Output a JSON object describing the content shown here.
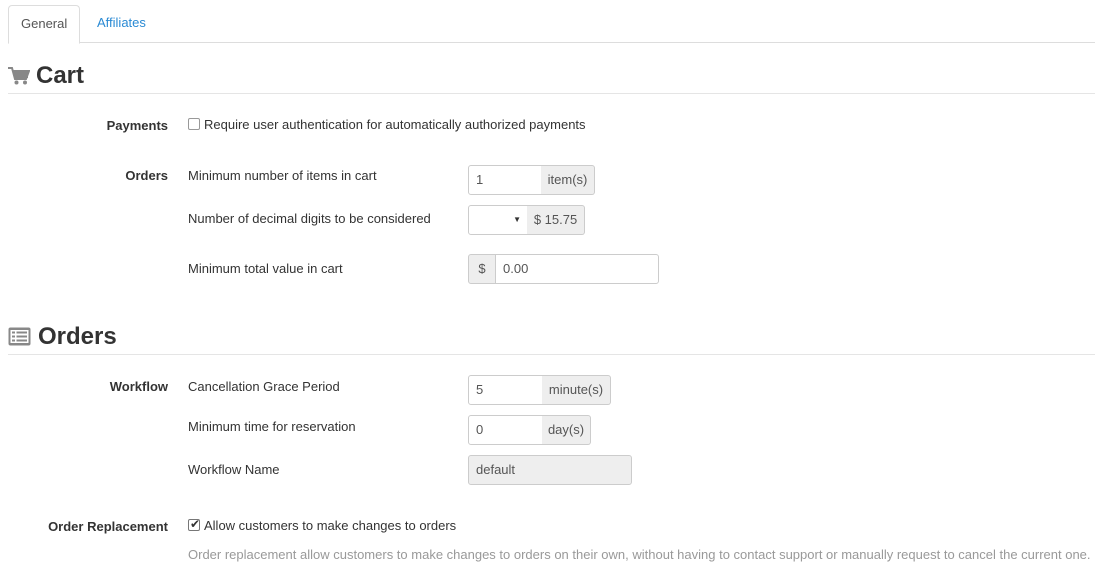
{
  "tabs": {
    "general": "General",
    "affiliates": "Affiliates"
  },
  "cart_section": {
    "title": "Cart",
    "icon": "shopping-cart-icon",
    "payments": {
      "label": "Payments",
      "checkbox_text": "Require user authentication for automatically authorized payments",
      "checked": false
    },
    "orders": {
      "label": "Orders",
      "min_items": {
        "label": "Minimum number of items in cart",
        "value": "1",
        "addon": "item(s)"
      },
      "decimal_digits": {
        "label": "Number of decimal digits to be considered",
        "value": "",
        "preview": "$ 15.75"
      },
      "min_total": {
        "label": "Minimum total value in cart",
        "prefix": "$",
        "value": "0.00"
      }
    }
  },
  "orders_section": {
    "title": "Orders",
    "icon": "list-icon",
    "workflow": {
      "label": "Workflow",
      "grace_period": {
        "label": "Cancellation Grace Period",
        "value": "5",
        "addon": "minute(s)"
      },
      "reservation": {
        "label": "Minimum time for reservation",
        "value": "0",
        "addon": "day(s)"
      },
      "workflow_name": {
        "label": "Workflow Name",
        "value": "default"
      }
    },
    "replacement": {
      "label": "Order Replacement",
      "checkbox_text": "Allow customers to make changes to orders",
      "checked": true,
      "help": "Order replacement allow customers to make changes to orders on their own, without having to contact support or manually request to cancel the current one."
    }
  }
}
